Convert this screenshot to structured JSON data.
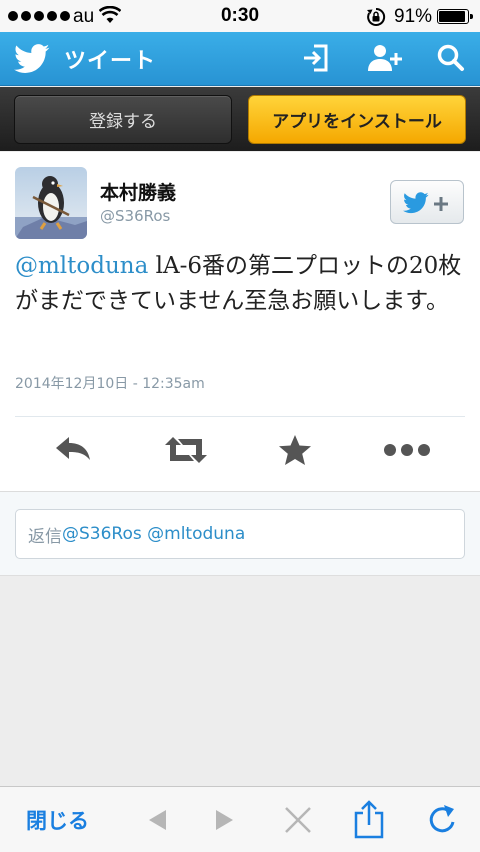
{
  "status_bar": {
    "carrier": "au",
    "time": "0:30",
    "battery_percent": "91%",
    "battery_level": 0.91
  },
  "topbar": {
    "title": "ツイート",
    "background": "#2a95d6"
  },
  "signup_bar": {
    "register_label": "登録する",
    "install_label": "アプリをインストール",
    "install_color": "#f8b400"
  },
  "tweet": {
    "author_name": "本村勝義",
    "author_handle": "@S36Ros",
    "mention": "@mltoduna",
    "body": " lA-6番の第二プロットの20枚がまだできていません至急お願いします。",
    "timestamp": "2014年12月10日 - 12:35am",
    "link_color": "#2d8ec9"
  },
  "actions": {
    "reply_icon": "reply-icon",
    "retweet_icon": "retweet-icon",
    "favorite_icon": "star-icon",
    "more_icon": "more-icon"
  },
  "reply": {
    "prefix": "返信",
    "mentions": "@S36Ros @mltoduna"
  },
  "browser_toolbar": {
    "close_label": "閉じる",
    "accent": "#1a7fe0"
  }
}
